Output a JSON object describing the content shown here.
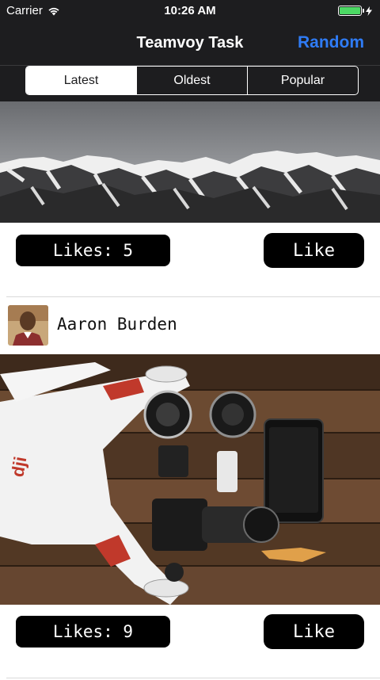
{
  "status_bar": {
    "carrier": "Carrier",
    "time": "10:26 AM",
    "wifi_icon": "wifi-icon",
    "battery_icon": "battery-icon",
    "battery_color": "#4cd964"
  },
  "nav": {
    "title": "Teamvoy Task",
    "random_label": "Random",
    "accent_color": "#2f7cf6"
  },
  "segments": {
    "items": [
      {
        "label": "Latest"
      },
      {
        "label": "Oldest"
      },
      {
        "label": "Popular"
      }
    ],
    "selected": "Latest"
  },
  "feed": {
    "posts": [
      {
        "photo": "mountain-landscape-photo",
        "likes_text": "Likes: 5",
        "like_label": "Like"
      },
      {
        "author": "Aaron Burden",
        "photo": "drone-camera-flatlay-photo",
        "likes_text": "Likes: 9",
        "like_label": "Like"
      }
    ]
  }
}
